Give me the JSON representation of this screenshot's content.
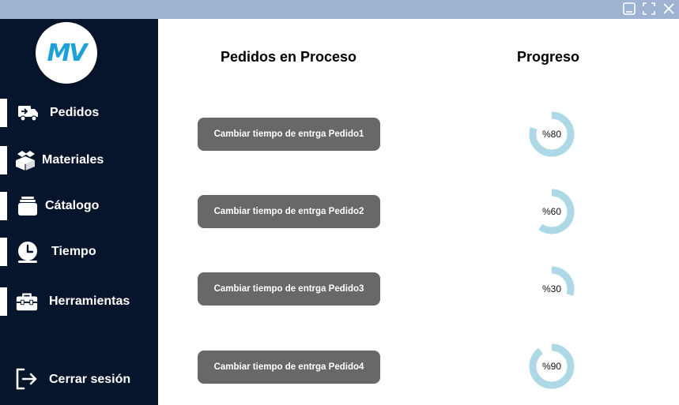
{
  "window": {
    "minimize_icon": "minimize-icon",
    "maximize_icon": "fullscreen-icon",
    "close_icon": "close-icon"
  },
  "logo": {
    "text": "MV"
  },
  "sidebar": {
    "items": [
      {
        "label": "Pedidos",
        "icon": "truck-icon"
      },
      {
        "label": "Materiales",
        "icon": "boxes-icon"
      },
      {
        "label": "Cátalogo",
        "icon": "catalog-icon"
      },
      {
        "label": "Tiempo",
        "icon": "clock-icon"
      },
      {
        "label": "Herramientas",
        "icon": "toolbox-icon"
      }
    ],
    "logout": {
      "label": "Cerrar sesión",
      "icon": "logout-icon"
    }
  },
  "main": {
    "orders_title": "Pedidos en Proceso",
    "progress_title": "Progreso",
    "orders": [
      {
        "button_label": "Cambiar tiempo de entrga Pedido1",
        "progress_label": "%80",
        "progress": 0.8
      },
      {
        "button_label": "Cambiar tiempo de entrga Pedido2",
        "progress_label": "%60",
        "progress": 0.6
      },
      {
        "button_label": "Cambiar tiempo de entrga Pedido3",
        "progress_label": "%30",
        "progress": 0.3
      },
      {
        "button_label": "Cambiar tiempo de entrga Pedido4",
        "progress_label": "%90",
        "progress": 0.9
      }
    ]
  },
  "colors": {
    "sidebar_bg": "#06152b",
    "titlebar_bg": "#9db3d1",
    "button_bg": "#686868",
    "ring_color": "#add8e6",
    "logo_accent": "#1ea0d8"
  }
}
